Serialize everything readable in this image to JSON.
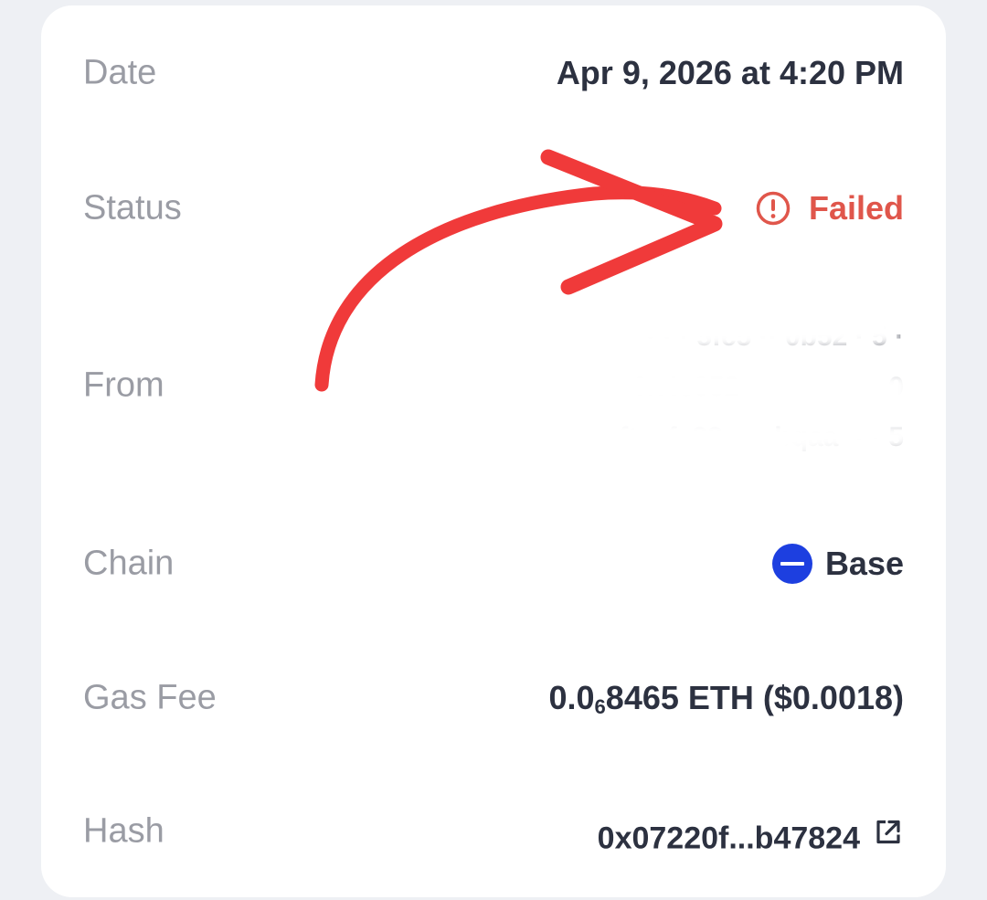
{
  "details": {
    "date": {
      "label": "Date",
      "value": "Apr 9, 2026 at 4:20 PM"
    },
    "status": {
      "label": "Status",
      "value": "Failed",
      "icon": "alert-circle-icon",
      "color": "#e0564b"
    },
    "from": {
      "label": "From",
      "address_lines": [
        "· · · 5fc5 ·· 0b52 · 5 ·",
        "0x4c052 ········ ·· ··· 0",
        "· · eeftsafa22 ···· bqaa ·· · 5"
      ]
    },
    "chain": {
      "label": "Chain",
      "value": "Base",
      "icon": "base-chain-icon",
      "icon_color": "#1d3fe0"
    },
    "gas_fee": {
      "label": "Gas Fee",
      "value_prefix": "0.0",
      "value_subscript": "6",
      "value_suffix": "8465 ETH ($0.0018)"
    },
    "hash": {
      "label": "Hash",
      "value": "0x07220f...b47824",
      "icon": "external-link-icon"
    }
  },
  "annotation": {
    "icon": "red-arrow-annotation",
    "color": "#f03a3a"
  }
}
